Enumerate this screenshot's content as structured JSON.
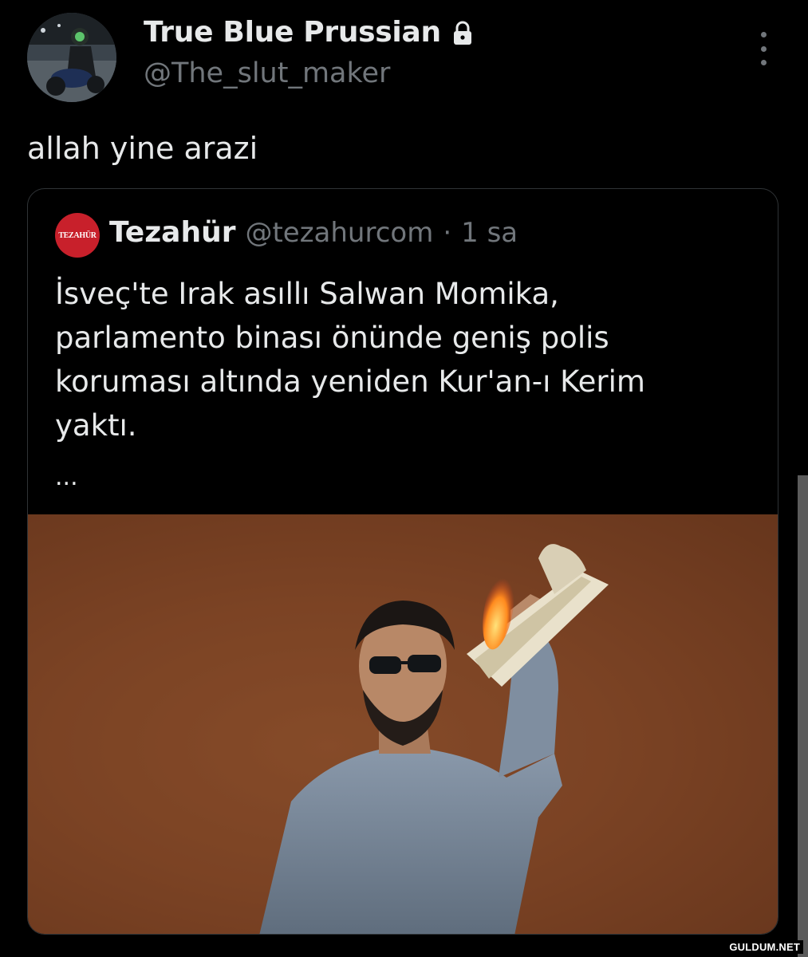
{
  "author": {
    "display_name": "True Blue Prussian",
    "handle": "@The_slut_maker",
    "lock_icon": "lock-icon",
    "avatar_icon": "avatar-photo"
  },
  "more_icon": "more-vertical-icon",
  "tweet": {
    "text": "allah yine arazi"
  },
  "quoted": {
    "logo_text": "TEZAHÜR",
    "name": "Tezahür",
    "handle": "@tezahurcom",
    "separator": "·",
    "time": "1 sa",
    "body_lines": [
      "İsveç'te Irak asıllı Salwan Momika,",
      "parlamento binası önünde geniş polis",
      "koruması altında yeniden Kur'an-ı Kerim",
      "yaktı."
    ],
    "ellipsis": "...",
    "media": "photo"
  },
  "watermark": "GULDUM.NET",
  "colors": {
    "background": "#000000",
    "text_primary": "#e7e9ea",
    "text_secondary": "#71767b",
    "border": "#2f3336",
    "logo_red": "#c8202b"
  }
}
